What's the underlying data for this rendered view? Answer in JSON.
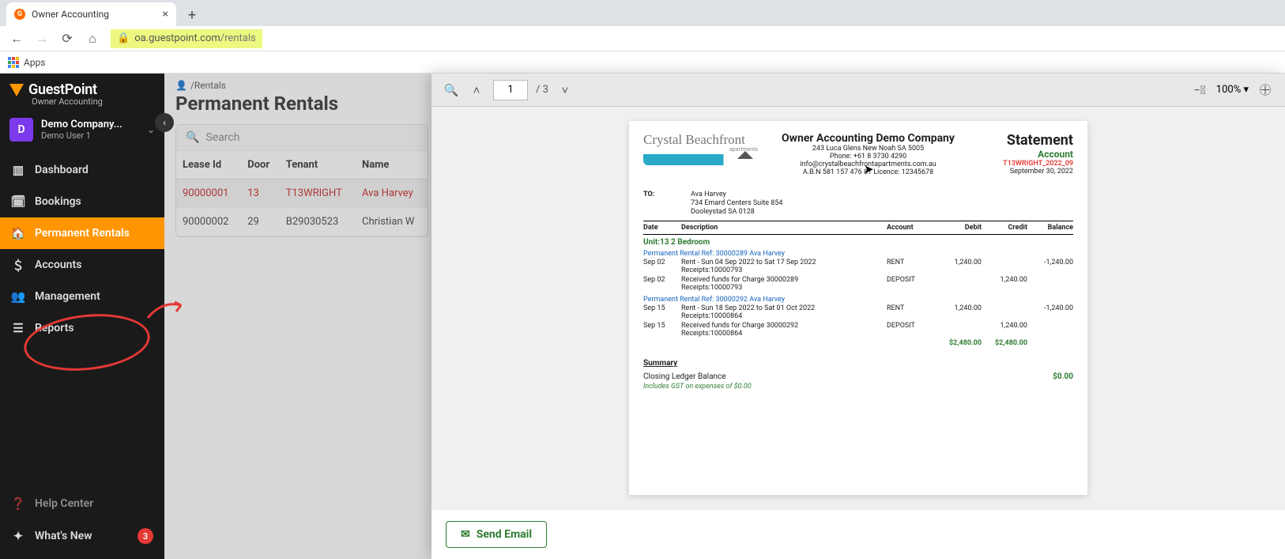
{
  "browser": {
    "tab_title": "Owner Accounting",
    "url_host": "oa.guestpoint.com",
    "url_path": "/rentals",
    "apps_label": "Apps"
  },
  "brand": {
    "name": "GuestPoint",
    "sub": "Owner Accounting"
  },
  "company": {
    "avatar_letter": "D",
    "name": "Demo Company...",
    "user": "Demo User 1"
  },
  "nav": {
    "dashboard": "Dashboard",
    "bookings": "Bookings",
    "permanent_rentals": "Permanent Rentals",
    "accounts": "Accounts",
    "management": "Management",
    "reports": "Reports",
    "help": "Help Center",
    "whats_new": "What's New",
    "whats_new_badge": "3"
  },
  "breadcrumb": "/Rentals",
  "page_title": "Permanent Rentals",
  "search_placeholder": "Search",
  "table": {
    "headers": {
      "lease": "Lease Id",
      "door": "Door",
      "tenant": "Tenant",
      "name": "Name"
    },
    "rows": [
      {
        "lease": "90000001",
        "door": "13",
        "tenant": "T13WRIGHT",
        "name": "Ava Harvey"
      },
      {
        "lease": "90000002",
        "door": "29",
        "tenant": "B29030523",
        "name": "Christian W"
      }
    ]
  },
  "pdf": {
    "page_current": "1",
    "page_total": "/ 3",
    "zoom": "100% ▾"
  },
  "statement": {
    "logo_name": "Crystal Beachfront",
    "logo_sub": "apartments",
    "company": "Owner Accounting Demo Company",
    "addr1": "243 Luca Glens New Noah SA 5005",
    "phone": "Phone: +61 8 3730 4290",
    "email": "info@crystalbeachfrontapartments.com.au",
    "abn": "A.B.N 581 157 476 81 Licence: 12345678",
    "title": "Statement",
    "account": "Account",
    "ref": "T13WRIGHT_2022_09",
    "date": "September 30, 2022",
    "to_label": "TO:",
    "to_name": "Ava Harvey",
    "to_addr1": "734 Emard Centers Suite 854",
    "to_addr2": "Dooleystad SA 0128",
    "hdr": {
      "date": "Date",
      "desc": "Description",
      "acc": "Account",
      "deb": "Debit",
      "cred": "Credit",
      "bal": "Balance"
    },
    "unit": "Unit:13 2 Bedroom",
    "ref1": "Permanent Rental Ref: 30000289 Ava Harvey",
    "r1": {
      "date": "Sep 02",
      "desc": "Rent - Sun 04 Sep 2022 to Sat 17 Sep 2022",
      "rec": "Receipts:10000793",
      "acc": "RENT",
      "deb": "1,240.00",
      "bal": "-1,240.00"
    },
    "r2": {
      "date": "Sep 02",
      "desc": "Received funds for Charge 30000289",
      "rec": "Receipts:10000793",
      "acc": "DEPOSIT",
      "cred": "1,240.00"
    },
    "ref2": "Permanent Rental Ref: 30000292 Ava Harvey",
    "r3": {
      "date": "Sep 15",
      "desc": "Rent - Sun 18 Sep 2022 to Sat 01 Oct 2022",
      "rec": "Receipts:10000864",
      "acc": "RENT",
      "deb": "1,240.00",
      "bal": "-1,240.00"
    },
    "r4": {
      "date": "Sep 15",
      "desc": "Received funds for Charge 30000292",
      "rec": "Receipts:10000864",
      "acc": "DEPOSIT",
      "cred": "1,240.00"
    },
    "tot": {
      "deb": "$2,480.00",
      "cred": "$2,480.00"
    },
    "summary": "Summary",
    "closing_label": "Closing Ledger Balance",
    "closing_amt": "$0.00",
    "gst": "Includes GST on expenses of $0.00"
  },
  "footer": {
    "send_email": "Send Email"
  }
}
